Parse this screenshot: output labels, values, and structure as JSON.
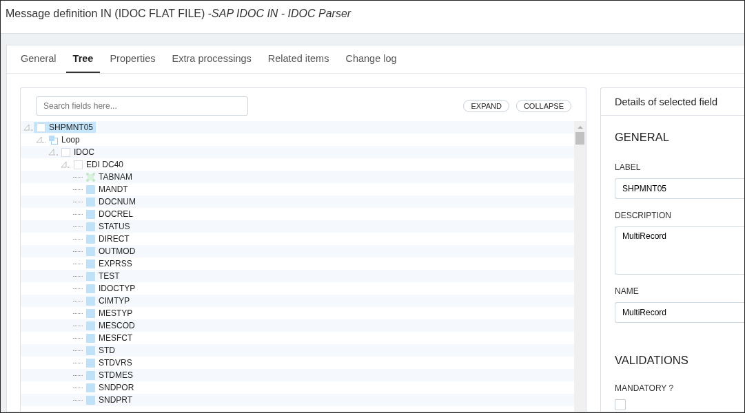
{
  "window": {
    "title": "Message definition IN (IDOC FLAT FILE) -",
    "title_italic": "SAP IDOC IN - IDOC Parser"
  },
  "tabs": [
    {
      "label": "General",
      "selected": false
    },
    {
      "label": "Tree",
      "selected": true
    },
    {
      "label": "Properties",
      "selected": false
    },
    {
      "label": "Extra processings",
      "selected": false
    },
    {
      "label": "Related items",
      "selected": false
    },
    {
      "label": "Change log",
      "selected": false
    }
  ],
  "tree": {
    "search": {
      "placeholder": "Search fields here..."
    },
    "buttons": [
      "EXPAND",
      "COLLAPSE"
    ],
    "nodes": [
      {
        "label": "SHPMNT05",
        "kind": "segment",
        "selected": true,
        "expanded": true,
        "children": [
          {
            "label": "Loop",
            "kind": "loop",
            "selected": false,
            "expanded": true,
            "children": [
              {
                "label": "IDOC",
                "kind": "segment",
                "selected": false,
                "expanded": true,
                "children": [
                  {
                    "label": "EDI DC40",
                    "kind": "segment",
                    "selected": false,
                    "expanded": true,
                    "children": [
                      {
                        "label": "TABNAM",
                        "kind": "key",
                        "selected": false
                      },
                      {
                        "label": "MANDT",
                        "kind": "field",
                        "selected": false
                      },
                      {
                        "label": "DOCNUM",
                        "kind": "field",
                        "selected": false
                      },
                      {
                        "label": "DOCREL",
                        "kind": "field",
                        "selected": false
                      },
                      {
                        "label": "STATUS",
                        "kind": "field",
                        "selected": false
                      },
                      {
                        "label": "DIRECT",
                        "kind": "field",
                        "selected": false
                      },
                      {
                        "label": "OUTMOD",
                        "kind": "field",
                        "selected": false
                      },
                      {
                        "label": "EXPRSS",
                        "kind": "field",
                        "selected": false
                      },
                      {
                        "label": "TEST",
                        "kind": "field",
                        "selected": false
                      },
                      {
                        "label": "IDOCTYP",
                        "kind": "field",
                        "selected": false
                      },
                      {
                        "label": "CIMTYP",
                        "kind": "field",
                        "selected": false
                      },
                      {
                        "label": "MESTYP",
                        "kind": "field",
                        "selected": false
                      },
                      {
                        "label": "MESCOD",
                        "kind": "field",
                        "selected": false
                      },
                      {
                        "label": "MESFCT",
                        "kind": "field",
                        "selected": false
                      },
                      {
                        "label": "STD",
                        "kind": "field",
                        "selected": false
                      },
                      {
                        "label": "STDVRS",
                        "kind": "field",
                        "selected": false
                      },
                      {
                        "label": "STDMES",
                        "kind": "field",
                        "selected": false
                      },
                      {
                        "label": "SNDPOR",
                        "kind": "field",
                        "selected": false
                      },
                      {
                        "label": "SNDPRT",
                        "kind": "field",
                        "selected": false
                      }
                    ]
                  }
                ]
              }
            ]
          }
        ]
      }
    ]
  },
  "details": {
    "header": "Details of selected field",
    "general": {
      "heading": "GENERAL",
      "label": {
        "caption": "LABEL",
        "value": "SHPMNT05"
      },
      "description": {
        "caption": "DESCRIPTION",
        "value": "MultiRecord"
      },
      "name": {
        "caption": "NAME",
        "value": "MultiRecord"
      }
    },
    "validations": {
      "heading": "VALIDATIONS",
      "mandatory": {
        "caption": "MANDATORY ?",
        "checked": false
      }
    }
  }
}
